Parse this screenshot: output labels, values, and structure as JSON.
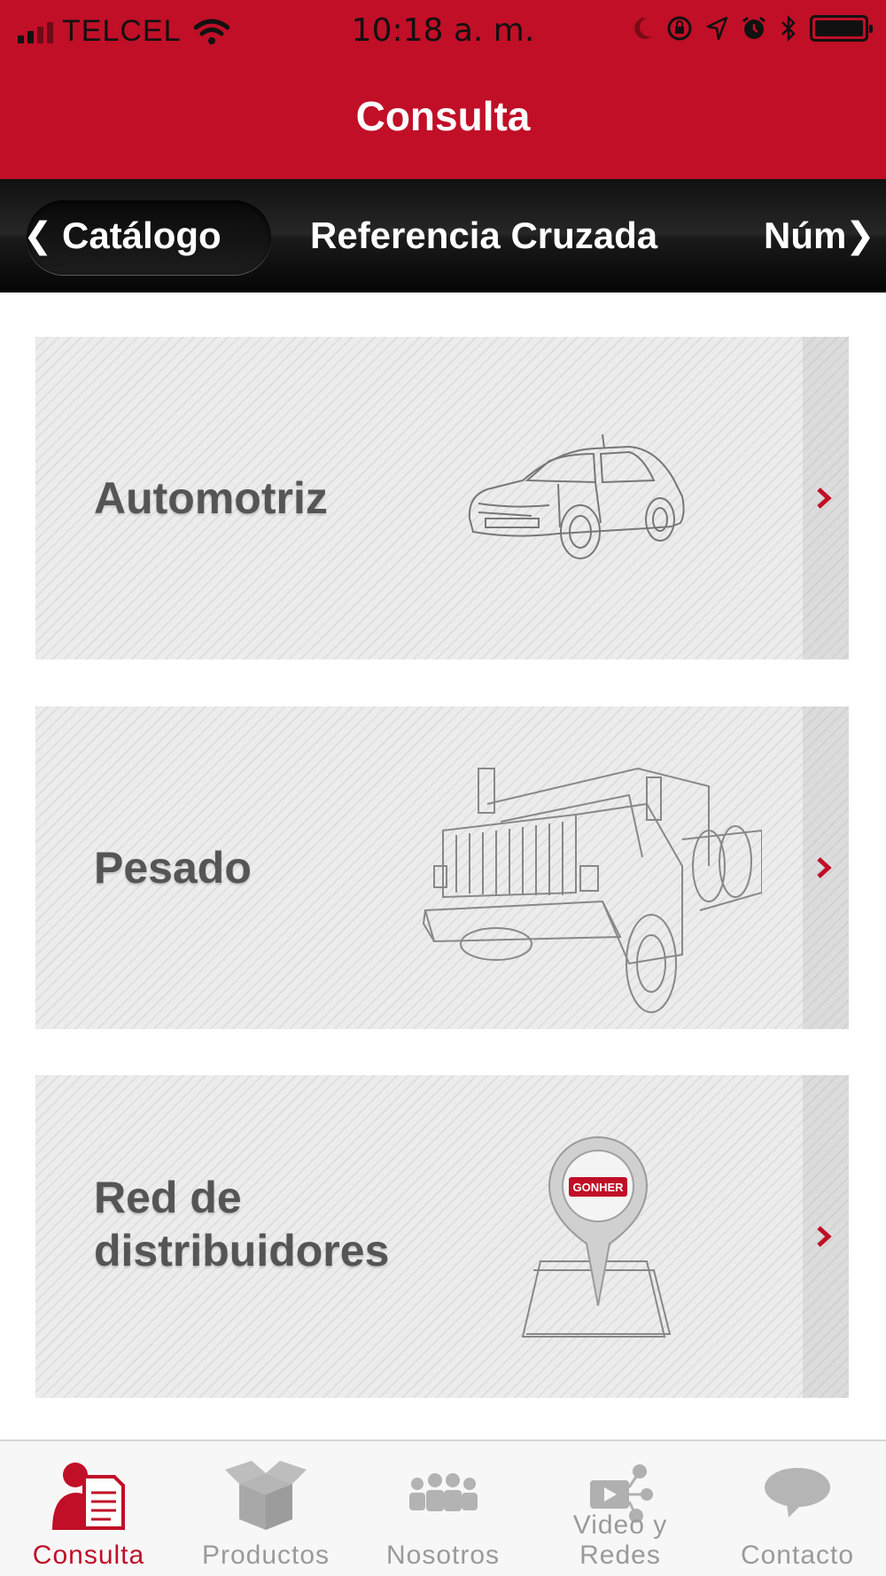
{
  "status_bar": {
    "carrier": "TELCEL",
    "time": "10:18 a. m.",
    "icons": [
      "signal-icon",
      "wifi-icon",
      "moon-icon",
      "rotation-lock-icon",
      "location-icon",
      "alarm-icon",
      "bluetooth-icon",
      "battery-icon"
    ]
  },
  "header": {
    "title": "Consulta"
  },
  "top_tabs": {
    "items": [
      {
        "label": "Catálogo",
        "active": true
      },
      {
        "label": "Referencia Cruzada",
        "active": false
      },
      {
        "label": "Núm",
        "active": false
      }
    ]
  },
  "cards": [
    {
      "label": "Automotriz",
      "icon": "car-icon"
    },
    {
      "label": "Pesado",
      "icon": "truck-icon"
    },
    {
      "label_line1": "Red de",
      "label_line2": "distribuidores",
      "icon": "map-pin-icon",
      "pin_text": "GONHER"
    }
  ],
  "bottom_tabs": {
    "items": [
      {
        "label": "Consulta",
        "icon": "document-icon",
        "active": true
      },
      {
        "label": "Productos",
        "icon": "box-icon",
        "active": false
      },
      {
        "label": "Nosotros",
        "icon": "people-icon",
        "active": false
      },
      {
        "label": "Video y Redes",
        "icon": "video-share-icon",
        "active": false
      },
      {
        "label": "Contacto",
        "icon": "chat-bubble-icon",
        "active": false
      }
    ]
  },
  "colors": {
    "brand_red": "#c00f27",
    "tab_bar_black": "#111111",
    "card_gray": "#ececec",
    "label_gray": "#555555",
    "inactive_tab": "#9a9a9a"
  }
}
